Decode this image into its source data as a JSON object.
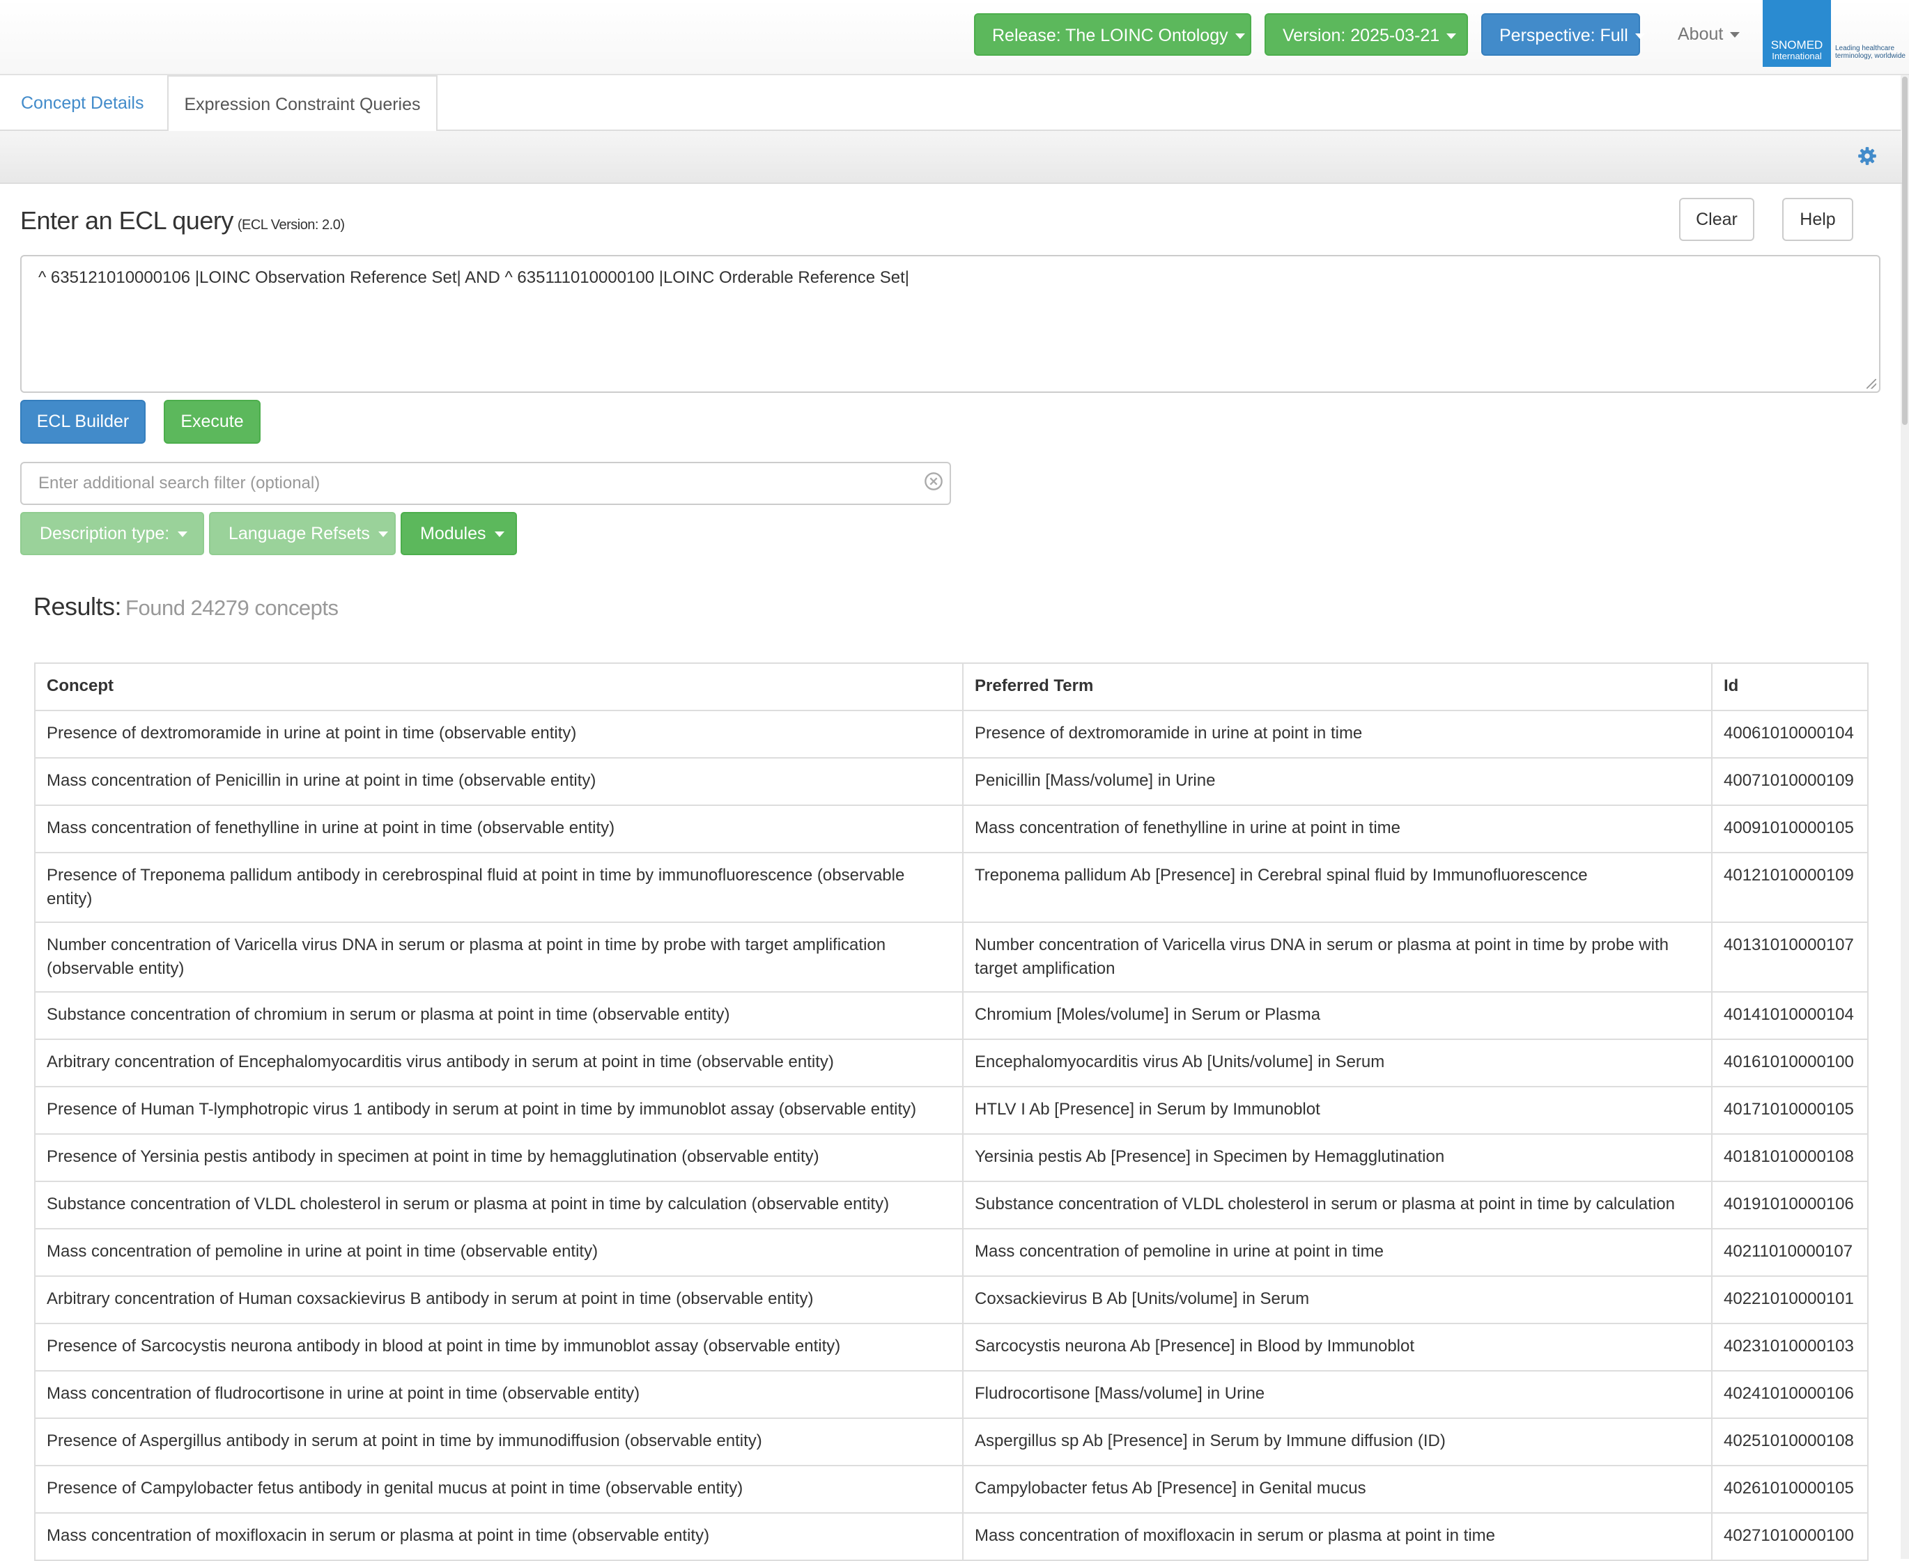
{
  "navbar": {
    "release_label": "Release: The LOINC Ontology",
    "version_label": "Version: 2025-03-21",
    "perspective_label": "Perspective: Full",
    "about_label": "About",
    "logo_line1": "SNOMED",
    "logo_line2": "International",
    "tagline_line1": "Leading healthcare",
    "tagline_line2": "terminology, worldwide"
  },
  "tabs": {
    "concept_details": "Concept Details",
    "ecl_queries": "Expression Constraint Queries"
  },
  "ecl": {
    "title": "Enter an ECL query",
    "version": "(ECL Version: 2.0)",
    "clear_label": "Clear",
    "help_label": "Help",
    "query": "^ 635121010000106 |LOINC Observation Reference Set| AND ^ 635111010000100 |LOINC Orderable Reference Set|",
    "builder_label": "ECL Builder",
    "execute_label": "Execute",
    "filter_placeholder": "Enter additional search filter (optional)",
    "description_type_label": "Description type:",
    "language_refsets_label": "Language Refsets",
    "modules_label": "Modules"
  },
  "results": {
    "title": "Results:",
    "count": "Found 24279 concepts",
    "columns": [
      "Concept",
      "Preferred Term",
      "Id"
    ],
    "rows": [
      [
        "Presence of dextromoramide in urine at point in time (observable entity)",
        "Presence of dextromoramide in urine at point in time",
        "40061010000104"
      ],
      [
        "Mass concentration of Penicillin in urine at point in time (observable entity)",
        "Penicillin [Mass/volume] in Urine",
        "40071010000109"
      ],
      [
        "Mass concentration of fenethylline in urine at point in time (observable entity)",
        "Mass concentration of fenethylline in urine at point in time",
        "40091010000105"
      ],
      [
        "Presence of Treponema pallidum antibody in cerebrospinal fluid at point in time by immunofluorescence (observable entity)",
        "Treponema pallidum Ab [Presence] in Cerebral spinal fluid by Immunofluorescence",
        "40121010000109"
      ],
      [
        "Number concentration of Varicella virus DNA in serum or plasma at point in time by probe with target amplification (observable entity)",
        "Number concentration of Varicella virus DNA in serum or plasma at point in time by probe with target amplification",
        "40131010000107"
      ],
      [
        "Substance concentration of chromium in serum or plasma at point in time (observable entity)",
        "Chromium [Moles/volume] in Serum or Plasma",
        "40141010000104"
      ],
      [
        "Arbitrary concentration of Encephalomyocarditis virus antibody in serum at point in time (observable entity)",
        "Encephalomyocarditis virus Ab [Units/volume] in Serum",
        "40161010000100"
      ],
      [
        "Presence of Human T-lymphotropic virus 1 antibody in serum at point in time by immunoblot assay (observable entity)",
        "HTLV I Ab [Presence] in Serum by Immunoblot",
        "40171010000105"
      ],
      [
        "Presence of Yersinia pestis antibody in specimen at point in time by hemagglutination (observable entity)",
        "Yersinia pestis Ab [Presence] in Specimen by Hemagglutination",
        "40181010000108"
      ],
      [
        "Substance concentration of VLDL cholesterol in serum or plasma at point in time by calculation (observable entity)",
        "Substance concentration of VLDL cholesterol in serum or plasma at point in time by calculation",
        "40191010000106"
      ],
      [
        "Mass concentration of pemoline in urine at point in time (observable entity)",
        "Mass concentration of pemoline in urine at point in time",
        "40211010000107"
      ],
      [
        "Arbitrary concentration of Human coxsackievirus B antibody in serum at point in time (observable entity)",
        "Coxsackievirus B Ab [Units/volume] in Serum",
        "40221010000101"
      ],
      [
        "Presence of Sarcocystis neurona antibody in blood at point in time by immunoblot assay (observable entity)",
        "Sarcocystis neurona Ab [Presence] in Blood by Immunoblot",
        "40231010000103"
      ],
      [
        "Mass concentration of fludrocortisone in urine at point in time (observable entity)",
        "Fludrocortisone [Mass/volume] in Urine",
        "40241010000106"
      ],
      [
        "Presence of Aspergillus antibody in serum at point in time by immunodiffusion (observable entity)",
        "Aspergillus sp Ab [Presence] in Serum by Immune diffusion (ID)",
        "40251010000108"
      ],
      [
        "Presence of Campylobacter fetus antibody in genital mucus at point in time (observable entity)",
        "Campylobacter fetus Ab [Presence] in Genital mucus",
        "40261010000105"
      ],
      [
        "Mass concentration of moxifloxacin in serum or plasma at point in time (observable entity)",
        "Mass concentration of moxifloxacin in serum or plasma at point in time",
        "40271010000100"
      ]
    ]
  },
  "icons": {
    "settings": "gear-icon",
    "clear_filter": "circle-x-icon",
    "dropdown": "caret-down-icon"
  },
  "colors": {
    "success": "#5cb85c",
    "primary": "#428bca",
    "success_disabled": "#9ad29a",
    "logo": "#2a8bd1"
  }
}
